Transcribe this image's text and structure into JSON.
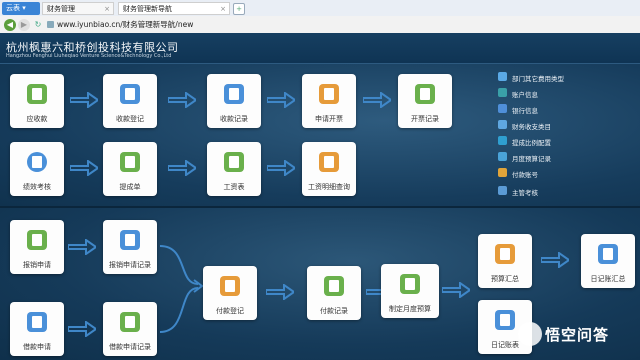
{
  "browser": {
    "tabs": [
      {
        "label": "云表"
      },
      {
        "label": "财务管理"
      },
      {
        "label": "财务管理新导航"
      }
    ],
    "url": "www.iyunbiao.cn/财务管理新导航/new"
  },
  "header": {
    "company_name": "杭州枫惠六和桥创投科技有限公司",
    "company_name_en": "Hangzhou Fenghui Liuheqiao Venture Science&Technology Co.,Ltd"
  },
  "flow_top": {
    "row1": [
      "应收款",
      "收款登记",
      "收款记录",
      "申请开票",
      "开票记录"
    ],
    "row2": [
      "绩效考核",
      "提成单",
      "工资表",
      "工资明细查询"
    ]
  },
  "legend": [
    {
      "label": "部门其它费用类型",
      "color": "#5aa9e6"
    },
    {
      "label": "账户信息",
      "color": "#3aa0a8"
    },
    {
      "label": "银行信息",
      "color": "#4f8fd9"
    },
    {
      "label": "财务收支类目",
      "color": "#5fa7e0"
    },
    {
      "label": "提成比例配置",
      "color": "#2f9fd0"
    },
    {
      "label": "月度预算记录",
      "color": "#4aa3d8"
    },
    {
      "label": "付款账号",
      "color": "#e0a43a"
    },
    {
      "label": "主管考核",
      "color": "#5b9bd5"
    }
  ],
  "flow_bottom": {
    "reimburse": [
      "报销申请",
      "报销申请记录"
    ],
    "loan": [
      "借款申请",
      "借款申请记录"
    ],
    "middle": [
      "付款登记",
      "付款记录",
      "制定月度预算"
    ],
    "right": [
      "预算汇总",
      "日记账汇总",
      "日记账表"
    ]
  },
  "watermark": {
    "text": "悟空问答"
  },
  "colors": {
    "green": "#6ab04c",
    "blue": "#4a90d9",
    "orange": "#e69b3a",
    "arrow": "#3f87c8"
  }
}
